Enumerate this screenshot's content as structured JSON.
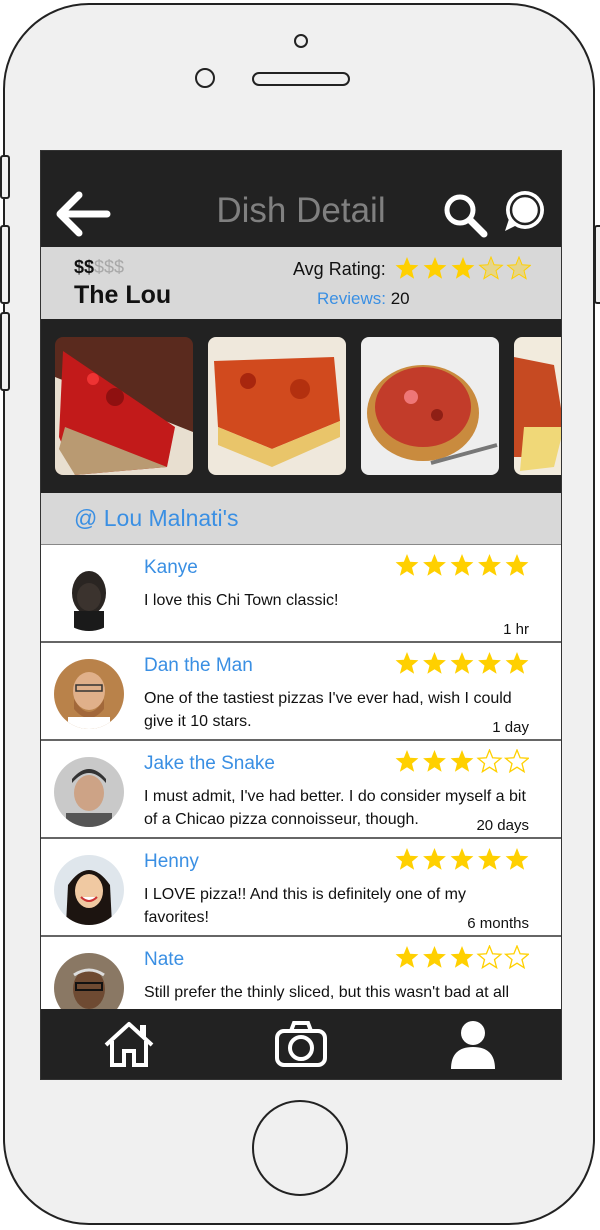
{
  "header": {
    "title": "Dish Detail",
    "back_icon": "arrow-left-icon",
    "search_icon": "search-icon",
    "chat_icon": "chat-bubble-icon"
  },
  "dish": {
    "price_on": "$$",
    "price_off": "$$$",
    "name": "The Lou",
    "avg_rating_label": "Avg Rating:",
    "avg_rating": 3,
    "avg_rating_max": 5,
    "reviews_label": "Reviews:",
    "reviews_count": "20"
  },
  "restaurant": {
    "label": "@ Lou Malnati's"
  },
  "reviews": [
    {
      "name": "Kanye",
      "rating": 5,
      "text": "I love this Chi Town classic!",
      "time": "1 hr"
    },
    {
      "name": "Dan the Man",
      "rating": 5,
      "text": "One of the tastiest pizzas I've ever had, wish I could give it 10 stars.",
      "time": "1 day"
    },
    {
      "name": "Jake the Snake",
      "rating": 3,
      "text": "I must admit, I've had better. I do consider myself a bit of a Chicao pizza connoisseur, though.",
      "time": "20 days"
    },
    {
      "name": "Henny",
      "rating": 5,
      "text": "I LOVE pizza!! And this is definitely one of my favorites!",
      "time": "6 months"
    },
    {
      "name": "Nate",
      "rating": 3,
      "text": "Still prefer the thinly sliced, but this wasn't bad at all",
      "time": ""
    }
  ],
  "tabbar": {
    "items": [
      "home-icon",
      "camera-icon",
      "profile-icon"
    ]
  },
  "colors": {
    "header_bg": "#222222",
    "bar_gray": "#d8d8d8",
    "accent_blue": "#3a8fe3",
    "star_gold": "#ffd000"
  }
}
